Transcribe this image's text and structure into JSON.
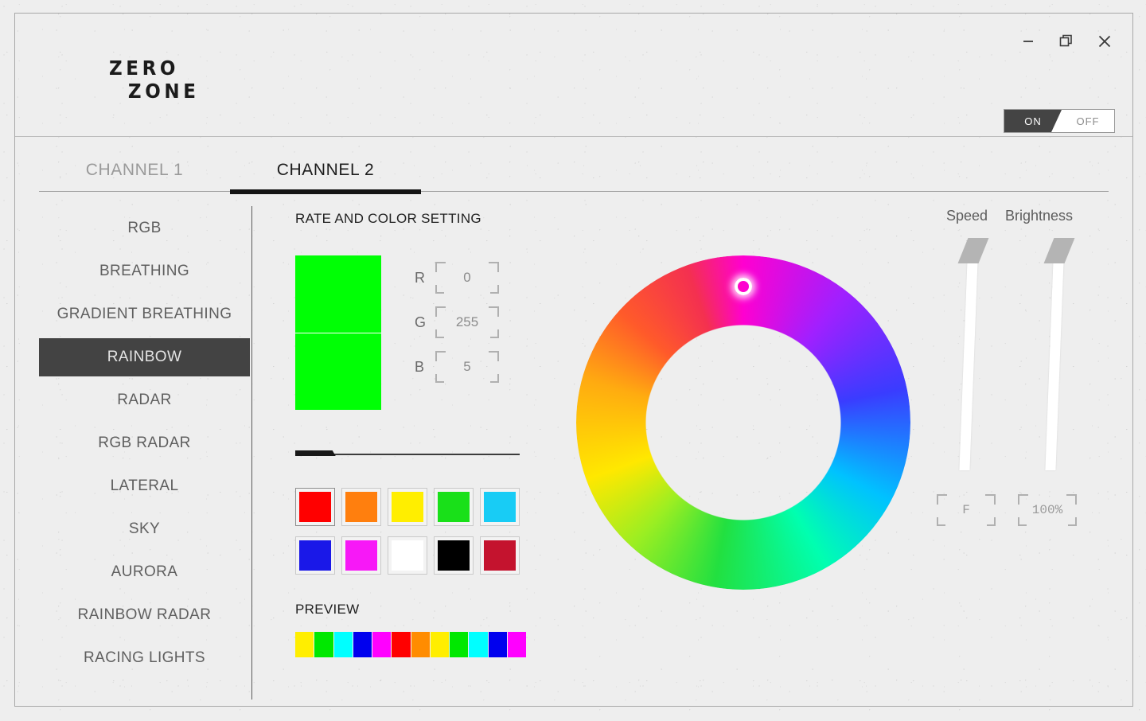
{
  "app": {
    "logo_line1": "ZERO",
    "logo_line2": "ZONE"
  },
  "window_controls": {
    "minimize": "–",
    "maximize": "maximize-icon",
    "close": "×"
  },
  "power_toggle": {
    "on_label": "ON",
    "off_label": "OFF",
    "state": "ON"
  },
  "tabs": [
    {
      "label": "CHANNEL 1",
      "active": false
    },
    {
      "label": "CHANNEL 2",
      "active": true
    }
  ],
  "sidebar": {
    "items": [
      {
        "label": "RGB",
        "active": false
      },
      {
        "label": "BREATHING",
        "active": false
      },
      {
        "label": "GRADIENT BREATHING",
        "active": false
      },
      {
        "label": "RAINBOW",
        "active": true
      },
      {
        "label": "RADAR",
        "active": false
      },
      {
        "label": "RGB RADAR",
        "active": false
      },
      {
        "label": "LATERAL",
        "active": false
      },
      {
        "label": "SKY",
        "active": false
      },
      {
        "label": "AURORA",
        "active": false
      },
      {
        "label": "RAINBOW RADAR",
        "active": false
      },
      {
        "label": "RACING LIGHTS",
        "active": false
      }
    ]
  },
  "main": {
    "section_title": "RATE AND COLOR SETTING",
    "current_color_hex": "#00ff05",
    "rgb": {
      "r_label": "R",
      "r_value": "0",
      "g_label": "G",
      "g_value": "255",
      "b_label": "B",
      "b_value": "5"
    },
    "rate_slider": {
      "fill_percent": 18
    },
    "palette": [
      {
        "name": "red",
        "hex": "#ff0000",
        "selected": true
      },
      {
        "name": "orange",
        "hex": "#ff7f0e",
        "selected": false
      },
      {
        "name": "yellow",
        "hex": "#ffee00",
        "selected": false
      },
      {
        "name": "green",
        "hex": "#19e019",
        "selected": false
      },
      {
        "name": "cyan",
        "hex": "#18ccf5",
        "selected": false
      },
      {
        "name": "blue",
        "hex": "#1a18e8",
        "selected": false
      },
      {
        "name": "magenta",
        "hex": "#f718f7",
        "selected": false
      },
      {
        "name": "white",
        "hex": "#ffffff",
        "selected": false
      },
      {
        "name": "black",
        "hex": "#000000",
        "selected": false
      },
      {
        "name": "crimson",
        "hex": "#c4132e",
        "selected": false
      }
    ],
    "preview_title": "PREVIEW",
    "preview_colors": [
      "#ffee00",
      "#00e800",
      "#00ffff",
      "#0000ee",
      "#ff00ff",
      "#ff0000",
      "#ff8c00",
      "#ffee00",
      "#00e800",
      "#00ffff",
      "#0000ee",
      "#ff00ff"
    ]
  },
  "color_wheel": {
    "name": "hue-ring",
    "handle_hue_deg": 0,
    "handle_position": "top"
  },
  "right_panel": {
    "speed_label": "Speed",
    "brightness_label": "Brightness",
    "speed_value": "F",
    "brightness_value": "100%",
    "speed_thumb_percent": 0,
    "brightness_thumb_percent": 0
  },
  "theme": {
    "background": "#eeeeee",
    "accent_dark": "#434343",
    "text_primary": "#1d1d1d",
    "text_muted": "#8d8d8d"
  }
}
